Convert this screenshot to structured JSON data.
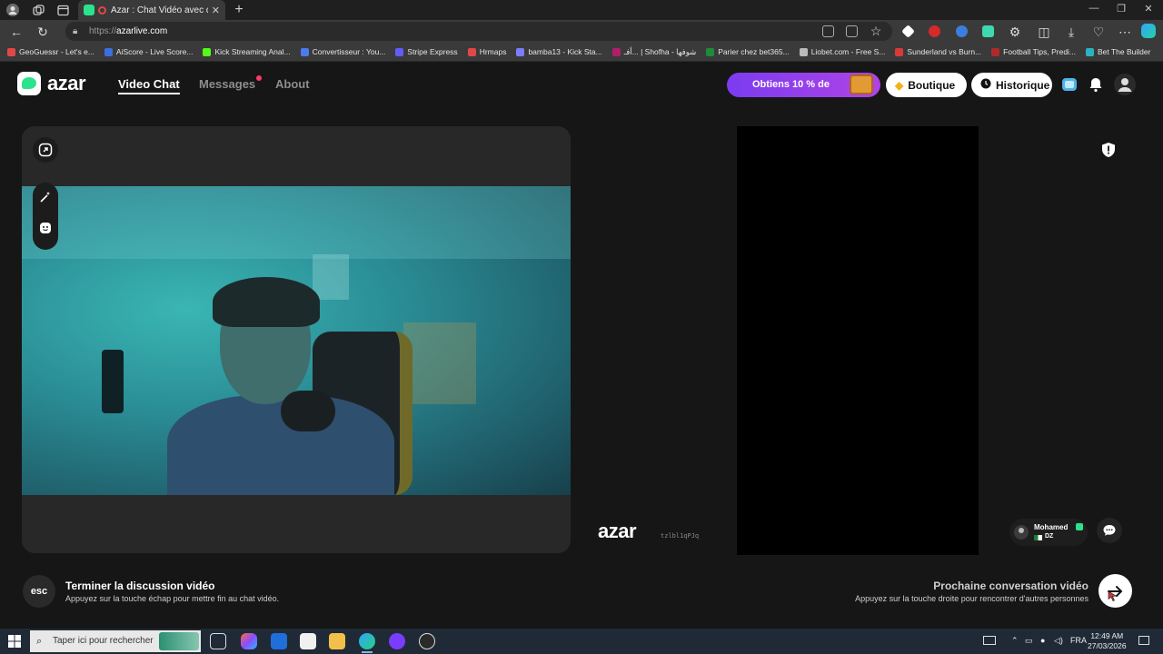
{
  "browser": {
    "tab_title": "Azar : Chat Vidéo avec de n",
    "url_prefix": "https://",
    "url_domain": "azarlive.com",
    "bookmarks": [
      {
        "label": "GeoGuessr - Let's e...",
        "color": "#e04848"
      },
      {
        "label": "AiScore - Live Score...",
        "color": "#3b6fe0"
      },
      {
        "label": "Kick Streaming Anal...",
        "color": "#53fc18"
      },
      {
        "label": "Convertisseur : You...",
        "color": "#4b7bec"
      },
      {
        "label": "Stripe Express",
        "color": "#635bff"
      },
      {
        "label": "Hrmaps",
        "color": "#e04848"
      },
      {
        "label": "bamba13 - Kick Sta...",
        "color": "#7c7cff"
      },
      {
        "label": "أفـ... | Shofha - شوفها",
        "color": "#b01e6b"
      },
      {
        "label": "Parier chez bet365...",
        "color": "#1f8a3a"
      },
      {
        "label": "Liobet.com - Free S...",
        "color": "#bbbbbb"
      },
      {
        "label": "Sunderland vs Burn...",
        "color": "#d83a3a"
      },
      {
        "label": "Football Tips, Predi...",
        "color": "#b02a2a"
      },
      {
        "label": "Bet The Builder",
        "color": "#2bb3c0"
      }
    ]
  },
  "header": {
    "logo": "azar",
    "nav": {
      "video_chat": "Video Chat",
      "messages": "Messages",
      "about": "About"
    },
    "promo": "Obtiens 10 % de",
    "boutique": "Boutique",
    "historique": "Historique"
  },
  "remote": {
    "watermark": "azar",
    "code": "tzlbl1qPJq",
    "partner_name": "Mohamed",
    "partner_country": "DZ"
  },
  "footer": {
    "esc_label": "esc",
    "end_title": "Terminer la discussion vidéo",
    "end_subtitle": "Appuyez sur la touche échap pour mettre fin au chat vidéo.",
    "next_title": "Prochaine conversation vidéo",
    "next_subtitle": "Appuyez sur la touche droite pour rencontrer d'autres personnes"
  },
  "taskbar": {
    "search_placeholder": "Taper ici pour rechercher",
    "language": "FRA",
    "time": "12:49 AM",
    "date": "27/03/2026"
  },
  "colors": {
    "accent": "#2be38c",
    "promo": "#8a3ff0",
    "notification": "#ff3a6a"
  }
}
